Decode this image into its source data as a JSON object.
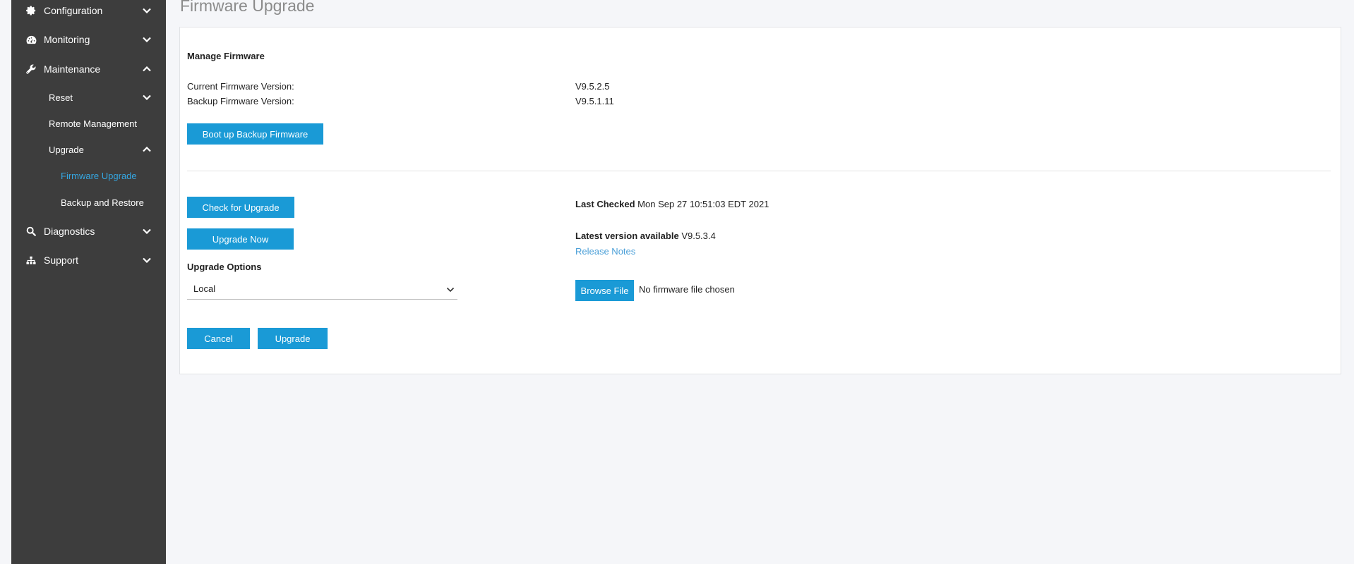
{
  "sidebar": {
    "items": [
      {
        "label": "Configuration",
        "icon": "gear-icon",
        "chevron": "down"
      },
      {
        "label": "Monitoring",
        "icon": "dashboard-icon",
        "chevron": "down"
      },
      {
        "label": "Maintenance",
        "icon": "wrench-icon",
        "chevron": "up"
      },
      {
        "label": "Reset",
        "chevron": "down"
      },
      {
        "label": "Remote Management"
      },
      {
        "label": "Upgrade",
        "chevron": "up"
      },
      {
        "label": "Firmware Upgrade",
        "active": true
      },
      {
        "label": "Backup and Restore"
      },
      {
        "label": "Diagnostics",
        "icon": "search-icon",
        "chevron": "down"
      },
      {
        "label": "Support",
        "icon": "sitemap-icon",
        "chevron": "down"
      }
    ],
    "active_color": "#35a7e2"
  },
  "page": {
    "title": "Firmware Upgrade"
  },
  "manage": {
    "heading": "Manage Firmware",
    "current_label": "Current Firmware Version:",
    "current_value": "V9.5.2.5",
    "backup_label": "Backup Firmware Version:",
    "backup_value": "V9.5.1.11",
    "boot_backup_button": "Boot up Backup Firmware"
  },
  "upgrade": {
    "check_button": "Check for Upgrade",
    "upgrade_now_button": "Upgrade Now",
    "last_checked_label": "Last Checked",
    "last_checked_value": "Mon Sep 27 10:51:03 EDT 2021",
    "latest_label": "Latest version available",
    "latest_value": "V9.5.3.4",
    "release_notes": "Release Notes",
    "options_label": "Upgrade Options",
    "options_selected": "Local",
    "browse_button": "Browse File",
    "file_status": "No firmware file chosen",
    "cancel_button": "Cancel",
    "upgrade_button": "Upgrade"
  },
  "colors": {
    "accent": "#1a9ad6",
    "sidebar_bg": "#3d3d3d",
    "link": "#4ca0d8"
  }
}
